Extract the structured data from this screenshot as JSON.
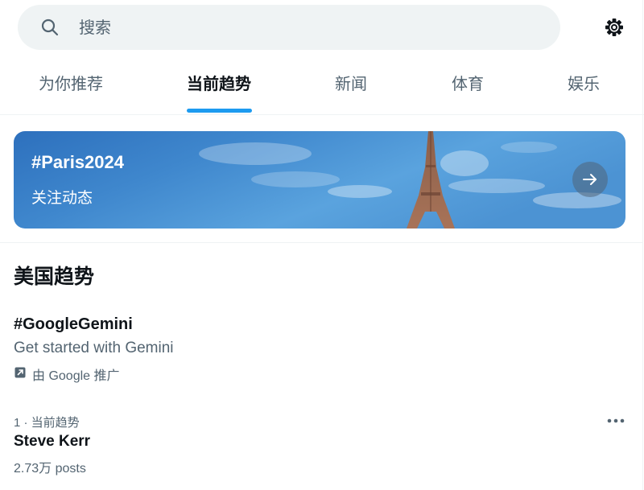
{
  "search": {
    "placeholder": "搜索",
    "icon": "search-icon"
  },
  "settings": {
    "icon": "gear-icon"
  },
  "tabs": [
    {
      "label": "为你推荐",
      "active": false
    },
    {
      "label": "当前趋势",
      "active": true
    },
    {
      "label": "新闻",
      "active": false
    },
    {
      "label": "体育",
      "active": false
    },
    {
      "label": "娱乐",
      "active": false
    }
  ],
  "banner": {
    "title": "#Paris2024",
    "subtitle": "关注动态",
    "arrow_icon": "arrow-right-icon",
    "image": "eiffel-tower-sky"
  },
  "section": {
    "title": "美国趋势"
  },
  "promoted": {
    "hashtag": "#GoogleGemini",
    "description": "Get started with Gemini",
    "promoted_by": "由 Google 推广",
    "icon": "promoted-icon"
  },
  "trends": [
    {
      "meta": "1 · 当前趋势",
      "name": "Steve Kerr",
      "posts": "2.73万 posts",
      "more_icon": "more-icon"
    }
  ],
  "colors": {
    "accent": "#1d9bf0",
    "text_primary": "#0f1419",
    "text_secondary": "#536471",
    "search_bg": "#eff3f4"
  }
}
